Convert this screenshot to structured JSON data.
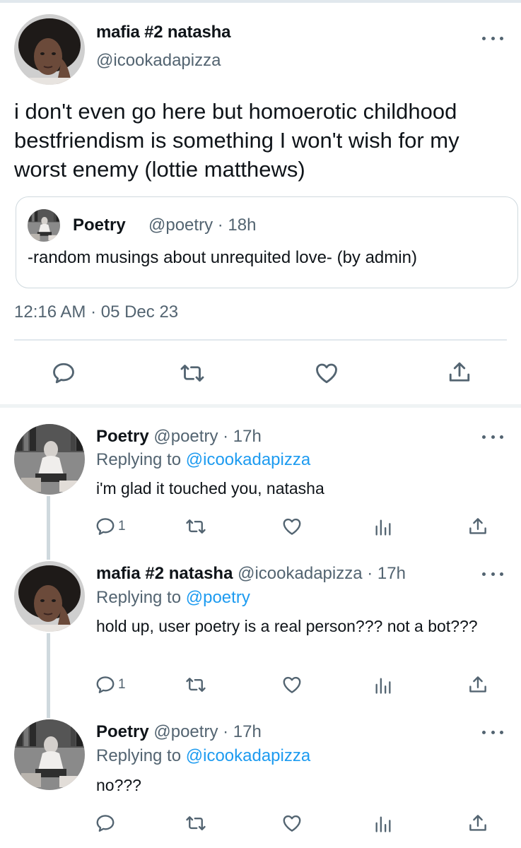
{
  "main_tweet": {
    "author_name": "mafia #2 natasha",
    "author_handle": "@icookadapizza",
    "text": "i don't even go here but homoerotic childhood bestfriendism is something I won't wish for my worst enemy (lottie matthews)",
    "quoted": {
      "author_name": "Poetry",
      "author_handle": "@poetry · 18h",
      "text": "-random musings about unrequited love- (by admin)"
    },
    "timestamp": "12:16 AM · 05 Dec 23"
  },
  "replies": [
    {
      "author_name": "Poetry",
      "meta": "@poetry · 17h",
      "replying_prefix": "Replying to ",
      "replying_to": "@icookadapizza",
      "text": "i'm glad it touched you, natasha",
      "reply_count": "1"
    },
    {
      "author_name": "mafia #2 natasha",
      "meta": "@icookadapizza · 17h",
      "replying_prefix": "Replying to ",
      "replying_to": "@poetry",
      "text": "hold up, user poetry is a real person??? not a bot???",
      "reply_count": "1"
    },
    {
      "author_name": "Poetry",
      "meta": "@poetry · 17h",
      "replying_prefix": "Replying to ",
      "replying_to": "@icookadapizza",
      "text": "no???",
      "reply_count": ""
    }
  ],
  "icons": {
    "reply": "reply-icon",
    "retweet": "retweet-icon",
    "like": "heart-icon",
    "analytics": "analytics-icon",
    "share": "share-icon",
    "more": "more-options-icon"
  },
  "colors": {
    "text": "#0f1419",
    "secondary": "#536471",
    "link": "#1d9bf0",
    "divider": "#e1e8ed"
  }
}
